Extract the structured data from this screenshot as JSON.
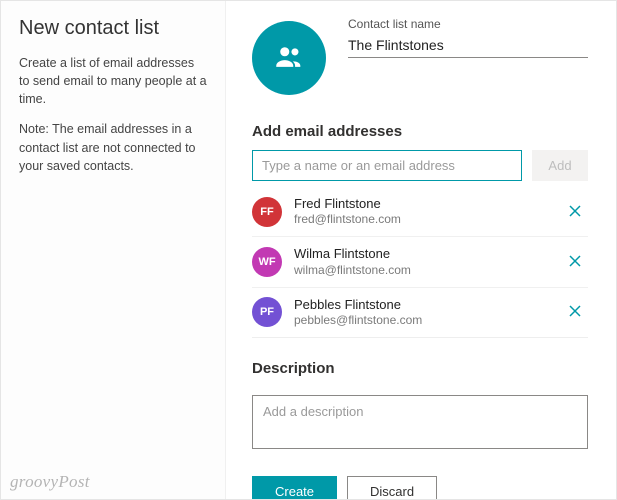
{
  "left": {
    "title": "New contact list",
    "para1": "Create a list of email addresses to send email to many people at a time.",
    "para2": "Note: The email addresses in a contact list are not connected to your saved contacts."
  },
  "header": {
    "name_label": "Contact list name",
    "name_value": "The Flintstones"
  },
  "email_section": {
    "heading": "Add email addresses",
    "input_placeholder": "Type a name or an email address",
    "add_label": "Add"
  },
  "contacts": [
    {
      "initials": "FF",
      "color": "#d13438",
      "name": "Fred Flintstone",
      "email": "fred@flintstone.com"
    },
    {
      "initials": "WF",
      "color": "#c239b3",
      "name": "Wilma Flintstone",
      "email": "wilma@flintstone.com"
    },
    {
      "initials": "PF",
      "color": "#7351d4",
      "name": "Pebbles Flintstone",
      "email": "pebbles@flintstone.com"
    }
  ],
  "description": {
    "heading": "Description",
    "placeholder": "Add a description"
  },
  "footer": {
    "create": "Create",
    "discard": "Discard"
  },
  "watermark": "groovyPost"
}
